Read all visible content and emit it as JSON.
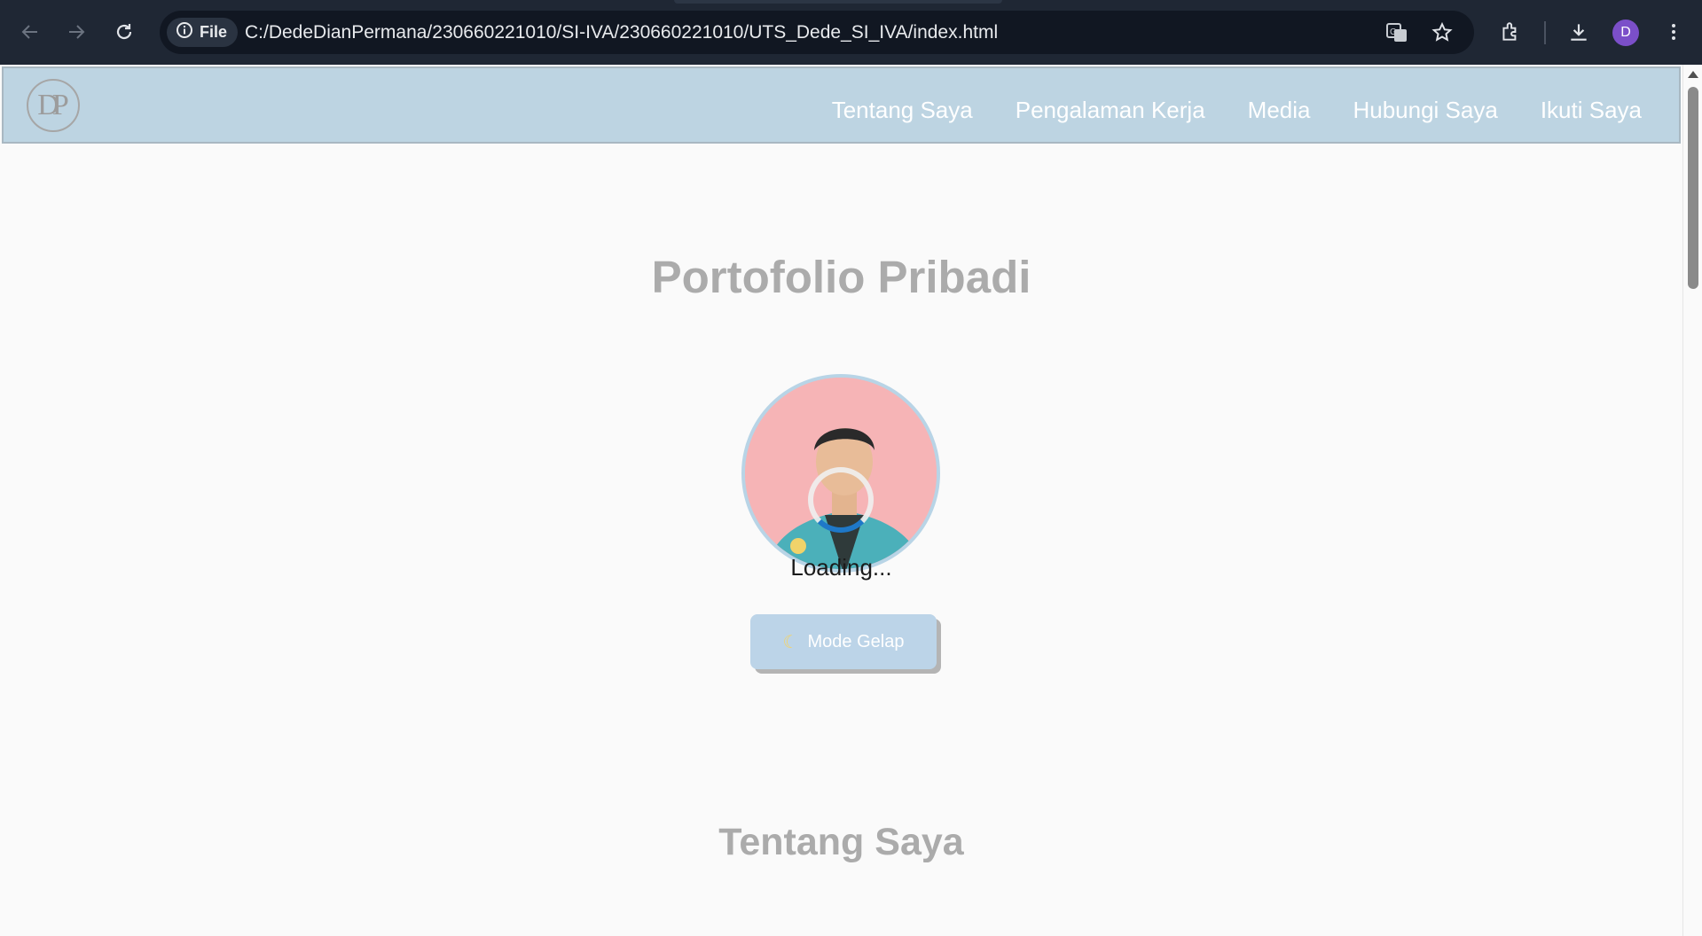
{
  "browser": {
    "site_chip_label": "File",
    "url": "C:/DedeDianPermana/230660221010/SI-IVA/230660221010/UTS_Dede_SI_IVA/index.html",
    "profile_initial": "D",
    "icons": [
      "back-icon",
      "forward-icon",
      "reload-icon",
      "info-icon",
      "translate-icon",
      "star-icon",
      "extensions-icon",
      "download-icon",
      "menu-icon"
    ]
  },
  "navbar": {
    "logo_text": "DP",
    "links": [
      {
        "label": "Tentang Saya"
      },
      {
        "label": "Pengalaman Kerja"
      },
      {
        "label": "Media"
      },
      {
        "label": "Hubungi Saya"
      },
      {
        "label": "Ikuti Saya"
      }
    ]
  },
  "hero": {
    "title": "Portofolio Pribadi",
    "loading_text": "Loading...",
    "mode_button_label": "Mode Gelap"
  },
  "sections": {
    "about_title": "Tentang Saya"
  },
  "colors": {
    "navbar_bg": "#bdd4e2",
    "page_bg": "#fafafa",
    "spinner_accent": "#1e78c8",
    "button_bg": "#bcd4e8",
    "chrome_bg": "#1f2734"
  }
}
